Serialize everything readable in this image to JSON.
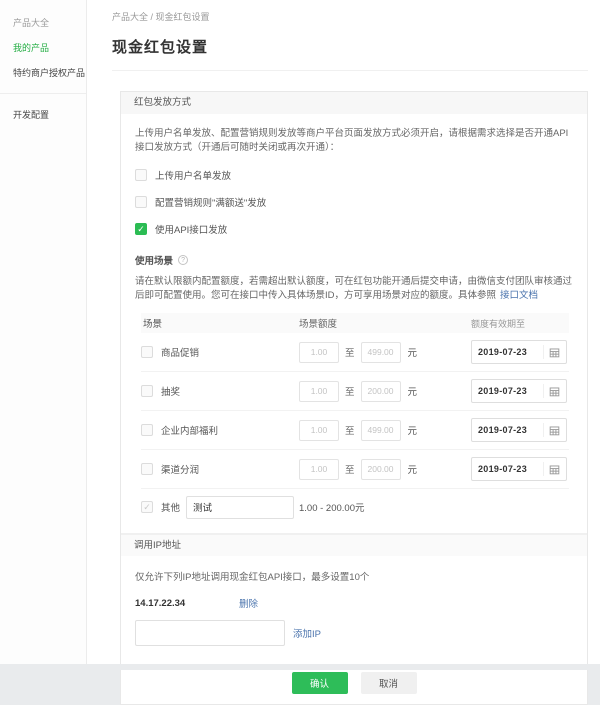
{
  "colors": {
    "accent_green": "#2ebd59",
    "link_blue": "#4b74ad",
    "active_menu_green": "#22ad42"
  },
  "sidebar": {
    "items": [
      {
        "label": "产品大全"
      },
      {
        "label": "我的产品"
      },
      {
        "label": "特约商户授权产品"
      },
      {
        "label": "开发配置"
      }
    ]
  },
  "breadcrumb": {
    "parent": "产品大全",
    "separator": " / ",
    "current": "现金红包设置"
  },
  "page": {
    "title": "现金红包设置"
  },
  "send_methods": {
    "header": "红包发放方式",
    "intro": "上传用户名单发放、配置营销规则发放等商户平台页面发放方式必须开启，请根据需求选择是否开通API接口发放方式（开通后可随时关闭或再次开通）：",
    "options": [
      {
        "label": "上传用户名单发放",
        "checked": false
      },
      {
        "label": "配置营销规则\"满额送\"发放",
        "checked": false
      },
      {
        "label": "使用API接口发放",
        "checked": true
      }
    ]
  },
  "usage_scenes": {
    "title": "使用场景",
    "info_icon": "?",
    "description": "请在默认限额内配置额度，若需超出默认额度，可在红包功能开通后提交申请，由微信支付团队审核通过后即可配置使用。您可在接口中传入具体场景ID，方可享用场景对应的额度。具体参照",
    "doc_link_label": "接口文档",
    "table": {
      "headers": [
        "场景",
        "场景额度",
        "额度有效期至"
      ],
      "to_label": "至",
      "unit_label": "元",
      "rows": [
        {
          "name": "商品促销",
          "min": "1.00",
          "max": "499.00",
          "date": "2019-07-23"
        },
        {
          "name": "抽奖",
          "min": "1.00",
          "max": "200.00",
          "date": "2019-07-23"
        },
        {
          "name": "企业内部福利",
          "min": "1.00",
          "max": "499.00",
          "date": "2019-07-23"
        },
        {
          "name": "渠道分润",
          "min": "1.00",
          "max": "200.00",
          "date": "2019-07-23"
        }
      ],
      "other": {
        "label": "其他",
        "value": "测试",
        "range": "1.00 - 200.00元"
      }
    }
  },
  "ip_section": {
    "header": "调用IP地址",
    "description": "仅允许下列IP地址调用现金红包API接口，最多设置10个",
    "entries": [
      {
        "address": "14.17.22.34",
        "delete_label": "删除"
      }
    ],
    "new_ip_value": "",
    "add_label": "添加IP"
  },
  "footer": {
    "confirm_label": "确认",
    "cancel_label": "取消"
  }
}
